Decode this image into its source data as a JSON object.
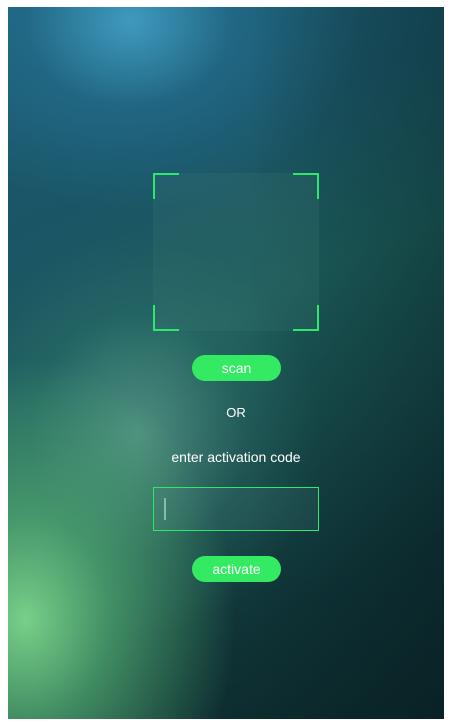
{
  "scanner": {
    "frame_icon": "qr-scan-frame-icon",
    "accent_color": "#2ee86a"
  },
  "scan_button": {
    "label": "scan"
  },
  "divider": {
    "label": "OR"
  },
  "activation": {
    "prompt": "enter activation code",
    "input_value": "",
    "button_label": "activate"
  },
  "colors": {
    "button_bg": "#34ea63",
    "text": "#ffffff"
  }
}
